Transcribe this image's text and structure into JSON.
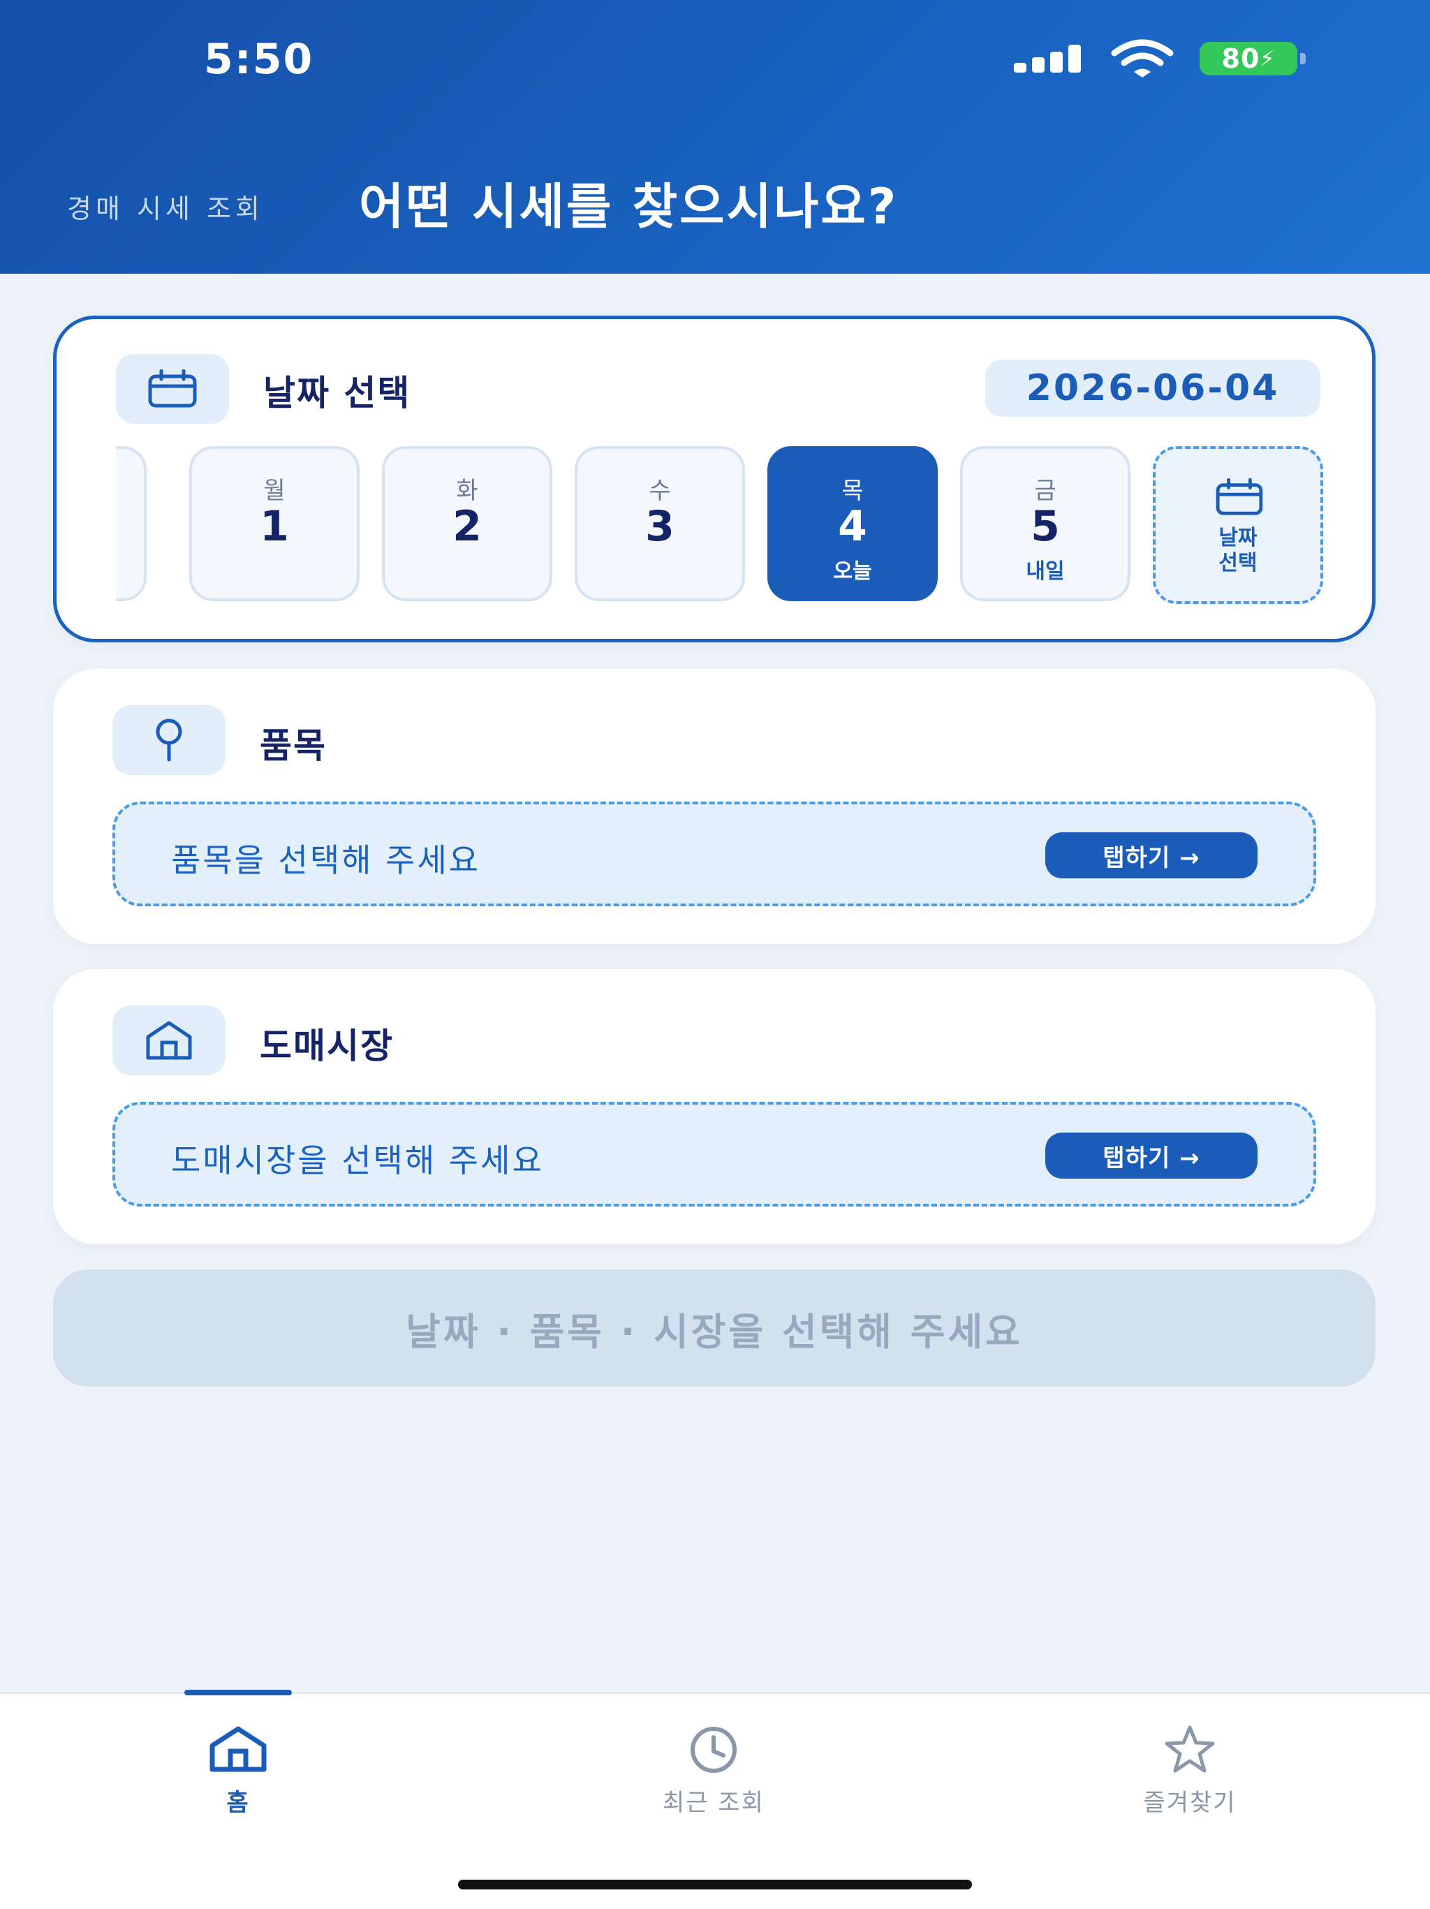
{
  "status_bar": {
    "time": "5:50",
    "battery": "80"
  },
  "header": {
    "subtitle": "경매 시세 조회",
    "title": "어떤 시세를 찾으시나요?"
  },
  "date_card": {
    "title": "날짜 선택",
    "selected_date": "2026-06-04",
    "days": [
      {
        "dow": "월",
        "num": "1",
        "sub": ""
      },
      {
        "dow": "화",
        "num": "2",
        "sub": ""
      },
      {
        "dow": "수",
        "num": "3",
        "sub": ""
      },
      {
        "dow": "목",
        "num": "4",
        "sub": "오늘"
      },
      {
        "dow": "금",
        "num": "5",
        "sub": "내일"
      }
    ],
    "pick_label_1": "날짜",
    "pick_label_2": "선택",
    "icon": "calendar-icon"
  },
  "item_card": {
    "title": "품목",
    "placeholder": "품목을 선택해 주세요",
    "tap_label": "탭하기 →",
    "icon": "pin-icon"
  },
  "market_card": {
    "title": "도매시장",
    "placeholder": "도매시장을 선택해 주세요",
    "tap_label": "탭하기 →",
    "icon": "market-icon"
  },
  "submit": {
    "label": "날짜 · 품목 · 시장을 선택해 주세요"
  },
  "tabs": [
    {
      "label": "홈",
      "icon": "home-icon"
    },
    {
      "label": "최근 조회",
      "icon": "clock-icon"
    },
    {
      "label": "즐겨찾기",
      "icon": "star-icon"
    }
  ],
  "colors": {
    "primary": "#1b5cb8",
    "header": "#1550a8",
    "accent_dashed": "#4a9ae8"
  }
}
